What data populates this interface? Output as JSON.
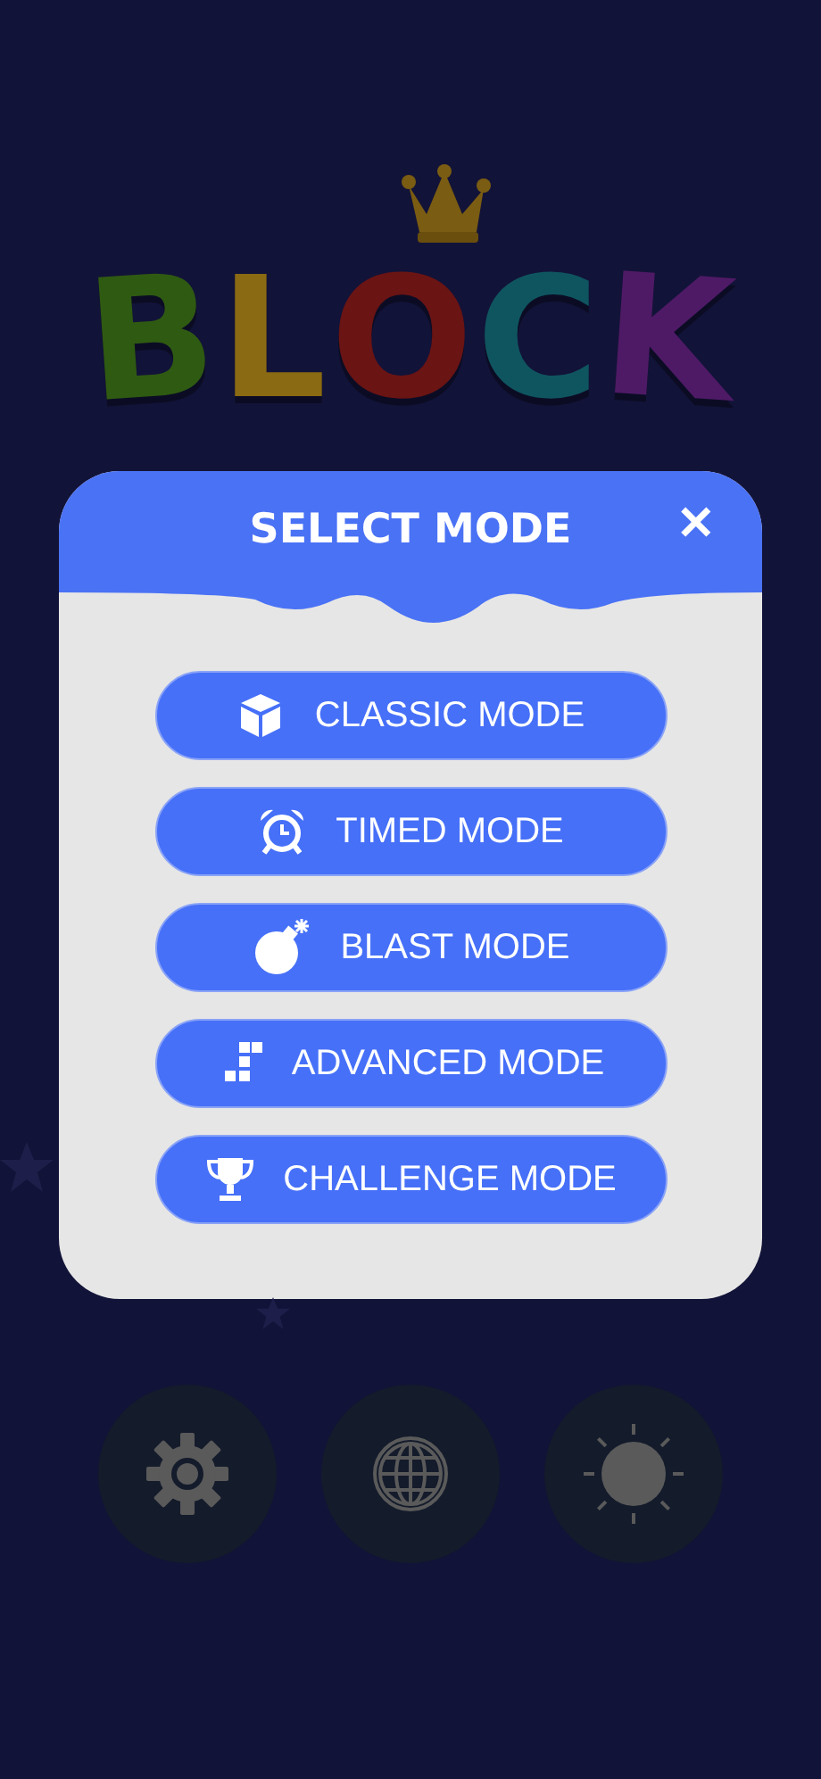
{
  "logo": {
    "letters": [
      {
        "char": "B",
        "color": "#2f5a12"
      },
      {
        "char": "L",
        "color": "#8a6a12"
      },
      {
        "char": "O",
        "color": "#6a1414"
      },
      {
        "char": "C",
        "color": "#0f5560"
      },
      {
        "char": "K",
        "color": "#4e1a66"
      }
    ]
  },
  "dialog": {
    "title": "SELECT MODE",
    "close": "✕",
    "modes": [
      {
        "kind": "cube",
        "label": "CLASSIC MODE"
      },
      {
        "kind": "clock",
        "label": "TIMED MODE"
      },
      {
        "kind": "bomb",
        "label": "BLAST MODE"
      },
      {
        "kind": "blocks",
        "label": "ADVANCED MODE"
      },
      {
        "kind": "trophy",
        "label": "CHALLENGE MODE"
      }
    ]
  },
  "bottom_buttons": [
    {
      "kind": "settings"
    },
    {
      "kind": "language"
    },
    {
      "kind": "brightness"
    }
  ]
}
